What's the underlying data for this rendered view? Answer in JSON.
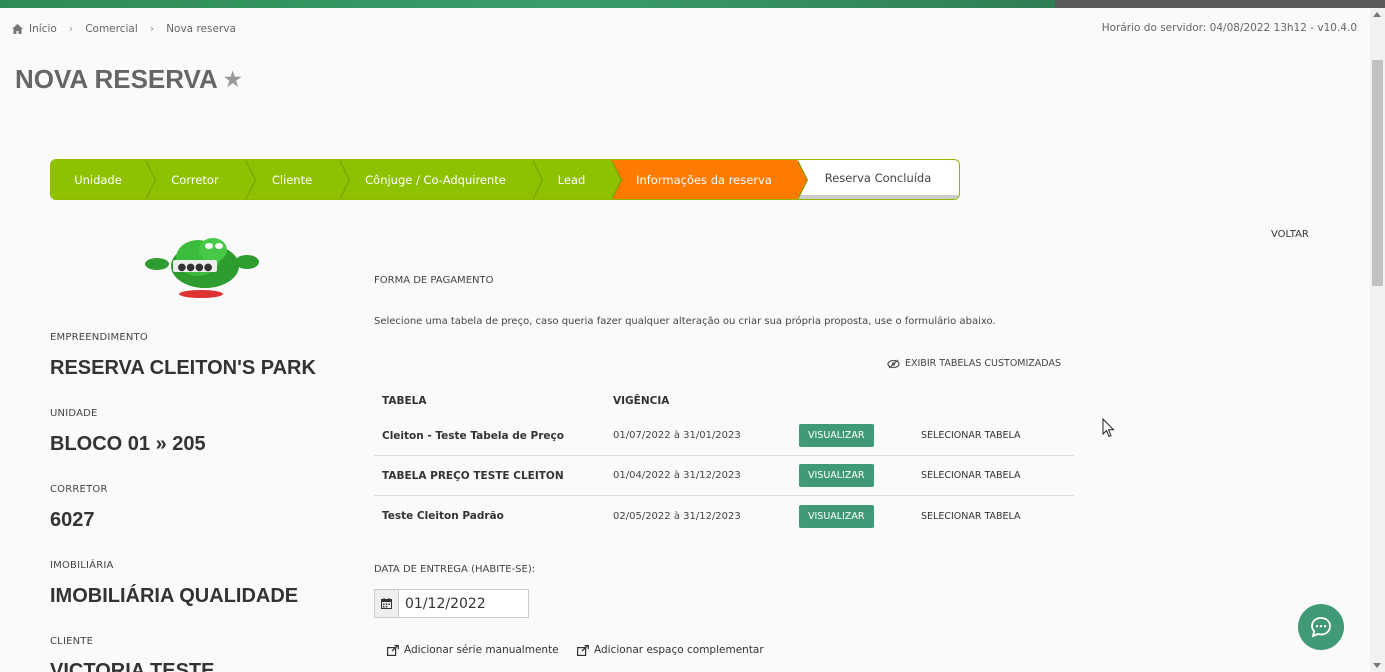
{
  "breadcrumb": {
    "home": "Início",
    "commercial": "Comercial",
    "current": "Nova reserva"
  },
  "server_time": "Horário do servidor: 04/08/2022 13h12 - v10.4.0",
  "page_title": "NOVA RESERVA",
  "steps": [
    {
      "label": "Unidade",
      "state": "done"
    },
    {
      "label": "Corretor",
      "state": "done"
    },
    {
      "label": "Cliente",
      "state": "done"
    },
    {
      "label": "Cônjuge / Co-Adquirente",
      "state": "done"
    },
    {
      "label": "Lead",
      "state": "done"
    },
    {
      "label": "Informações da reserva",
      "state": "active"
    },
    {
      "label": "Reserva Concluída",
      "state": "pending"
    }
  ],
  "voltar": "VOLTAR",
  "info": {
    "empreendimento_label": "EMPREENDIMENTO",
    "empreendimento": "RESERVA CLEITON'S PARK",
    "unidade_label": "UNIDADE",
    "unidade": "BLOCO 01 » 205",
    "corretor_label": "CORRETOR",
    "corretor": "6027",
    "imobiliaria_label": "IMOBILIÁRIA",
    "imobiliaria": "IMOBILIÁRIA QUALIDADE",
    "cliente_label": "CLIENTE",
    "cliente": "VICTORIA TESTE"
  },
  "payment": {
    "title": "FORMA DE PAGAMENTO",
    "hint": "Selecione uma tabela de preço, caso queria fazer qualquer alteração ou criar sua própria proposta, use o formulário abaixo.",
    "show_custom": "EXIBIR TABELAS CUSTOMIZADAS",
    "col_tabela": "TABELA",
    "col_vigencia": "VIGÊNCIA",
    "rows": [
      {
        "name": "Cleiton - Teste Tabela de Preço",
        "period": "01/07/2022 à 31/01/2023",
        "view": "VISUALIZAR",
        "select": "SELECIONAR TABELA"
      },
      {
        "name": "TABELA PREÇO TESTE CLEITON",
        "period": "01/04/2022 à 31/12/2023",
        "view": "VISUALIZAR",
        "select": "SELECIONAR TABELA"
      },
      {
        "name": "Teste Cleiton Padrão",
        "period": "02/05/2022 à 31/12/2023",
        "view": "VISUALIZAR",
        "select": "SELECIONAR TABELA"
      }
    ]
  },
  "delivery": {
    "label": "DATA DE ENTREGA (HABITE-SE):",
    "value": "01/12/2022"
  },
  "actions": {
    "add_series": "Adicionar série manualmente",
    "add_space": "Adicionar espaço complementar"
  },
  "colors": {
    "green_step": "#8ec200",
    "orange_step": "#ff7a00",
    "button_green": "#3f9a75"
  }
}
